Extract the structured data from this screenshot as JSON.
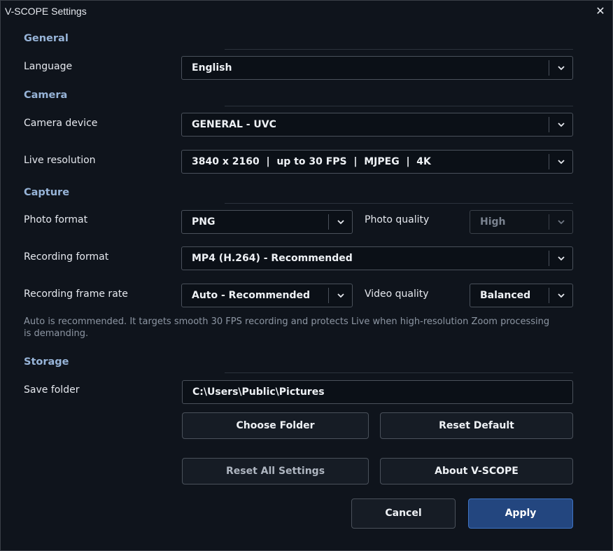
{
  "window": {
    "title": "V-SCOPE Settings",
    "close_glyph": "✕"
  },
  "sections": {
    "general": "General",
    "camera": "Camera",
    "capture": "Capture",
    "storage": "Storage"
  },
  "general": {
    "language_label": "Language",
    "language_value": "English"
  },
  "camera": {
    "device_label": "Camera device",
    "device_value": "GENERAL - UVC",
    "resolution_label": "Live resolution",
    "resolution_value": "3840 x 2160  |  up to 30 FPS  |  MJPEG  |  4K"
  },
  "capture": {
    "photo_format_label": "Photo format",
    "photo_format_value": "PNG",
    "photo_quality_label": "Photo quality",
    "photo_quality_value": "High",
    "recording_format_label": "Recording format",
    "recording_format_value": "MP4 (H.264) - Recommended",
    "frame_rate_label": "Recording frame rate",
    "frame_rate_value": "Auto - Recommended",
    "video_quality_label": "Video quality",
    "video_quality_value": "Balanced",
    "note": "Auto is recommended. It targets smooth 30 FPS recording and protects Live when high-resolution Zoom processing is demanding."
  },
  "storage": {
    "folder_label": "Save folder",
    "folder_value": "C:\\Users\\Public\\Pictures",
    "choose_folder": "Choose Folder",
    "reset_default": "Reset Default"
  },
  "actions": {
    "reset_all": "Reset All Settings",
    "about": "About V-SCOPE",
    "cancel": "Cancel",
    "apply": "Apply"
  },
  "icons": {
    "dropdown": "chevron-down-icon",
    "close": "close-icon"
  },
  "colors": {
    "accent": "#23467f",
    "section_heading": "#97b4d8",
    "background": "#0f141c"
  }
}
